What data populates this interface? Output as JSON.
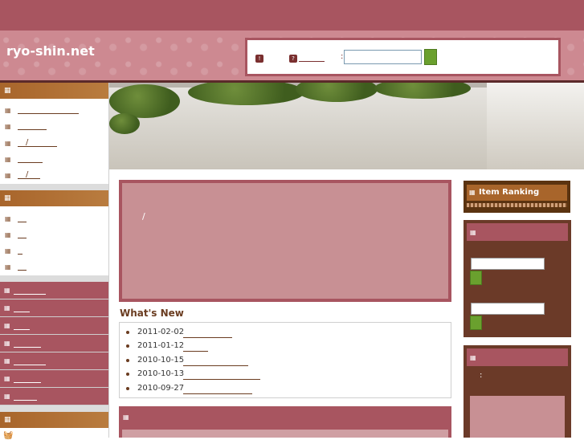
{
  "site": {
    "title": "ryo-shin.net"
  },
  "search": {
    "colon": ":",
    "badge1": "!",
    "badge2": "?"
  },
  "left_menu": {
    "section1_items": [
      "",
      "",
      "/",
      "",
      "/"
    ],
    "section2_items": [
      "",
      "",
      "",
      ""
    ]
  },
  "main": {
    "slash": "/"
  },
  "whats_new": {
    "title": "What's New",
    "items": [
      {
        "date": "2011-02-02"
      },
      {
        "date": "2011-01-12"
      },
      {
        "date": "2010-10-15"
      },
      {
        "date": "2010-10-13"
      },
      {
        "date": "2010-09-27"
      }
    ]
  },
  "right": {
    "ranking_label": "Item Ranking",
    "colon": ":"
  },
  "colors": {
    "accent": "#a85560",
    "brown": "#a8652b",
    "dark_brown": "#6b3a28"
  }
}
